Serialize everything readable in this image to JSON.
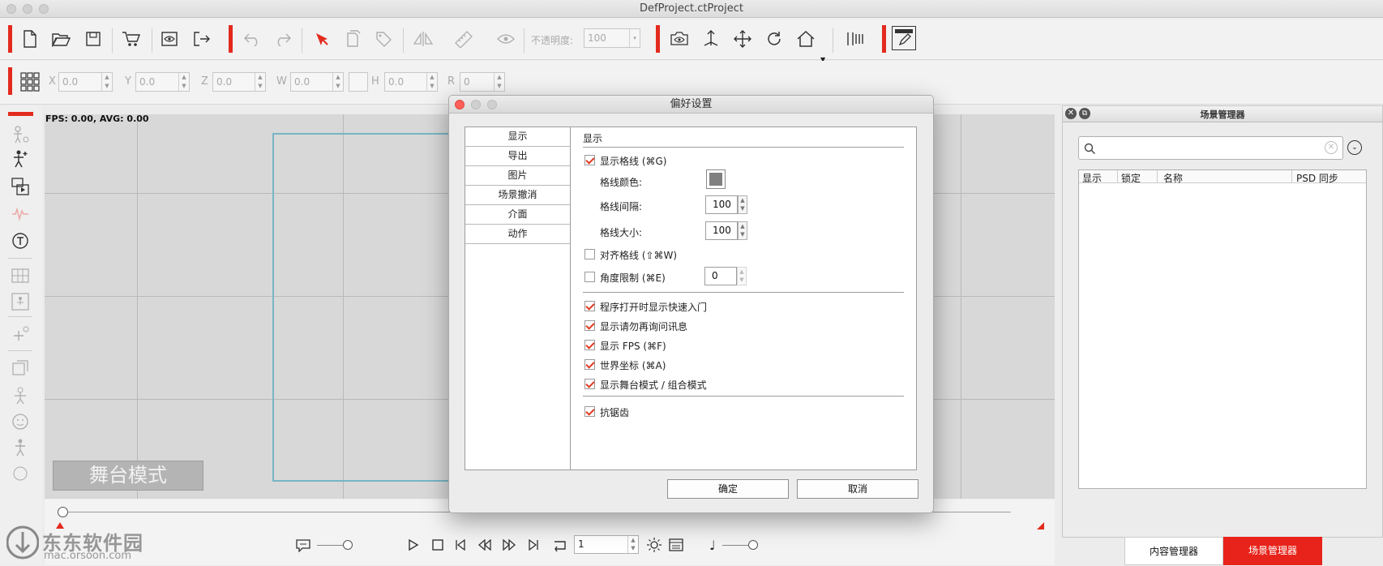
{
  "window": {
    "title": "DefProject.ctProject"
  },
  "toolbar": {
    "opacity_label": "不透明度:",
    "opacity_value": "100"
  },
  "transform": {
    "x": {
      "label": "X",
      "value": "0.0"
    },
    "y": {
      "label": "Y",
      "value": "0.0"
    },
    "z": {
      "label": "Z",
      "value": "0.0"
    },
    "w": {
      "label": "W",
      "value": "0.0"
    },
    "h": {
      "label": "H",
      "value": "0.0"
    },
    "r": {
      "label": "R",
      "value": "0"
    }
  },
  "canvas": {
    "fps": "FPS: 0.00, AVG: 0.00",
    "mode_label": "舞台模式"
  },
  "playback": {
    "frame": "1"
  },
  "watermark": {
    "text": "东东软件园",
    "url": "mac.orsoon.com"
  },
  "scene_panel": {
    "title": "场景管理器",
    "search_placeholder": "",
    "columns": [
      "显示",
      "锁定",
      "名称",
      "PSD 同步"
    ]
  },
  "bottom_tabs": [
    {
      "label": "内容管理器",
      "active": false
    },
    {
      "label": "场景管理器",
      "active": true
    }
  ],
  "colors": {
    "accent": "#e32a1e",
    "grid_color": "#808080"
  },
  "dialog": {
    "title": "偏好设置",
    "nav": [
      "显示",
      "导出",
      "图片",
      "场景撤消",
      "介面",
      "动作"
    ],
    "section_title": "显示",
    "show_grid": {
      "label": "显示格线 (⌘G)",
      "checked": true
    },
    "grid_color_label": "格线颜色:",
    "grid_spacing": {
      "label": "格线间隔:",
      "value": "100"
    },
    "grid_size": {
      "label": "格线大小:",
      "value": "100"
    },
    "snap_grid": {
      "label": "对齐格线 (⇧⌘W)",
      "checked": false
    },
    "angle_limit": {
      "label": "角度限制 (⌘E)",
      "checked": false,
      "value": "0"
    },
    "options": [
      {
        "label": "程序打开时显示快速入门",
        "checked": true
      },
      {
        "label": "显示请勿再询问讯息",
        "checked": true
      },
      {
        "label": "显示 FPS (⌘F)",
        "checked": true
      },
      {
        "label": "世界坐标 (⌘A)",
        "checked": true
      },
      {
        "label": "显示舞台模式 / 组合模式",
        "checked": true
      }
    ],
    "antialias": {
      "label": "抗锯齿",
      "checked": true
    },
    "ok_label": "确定",
    "cancel_label": "取消"
  }
}
